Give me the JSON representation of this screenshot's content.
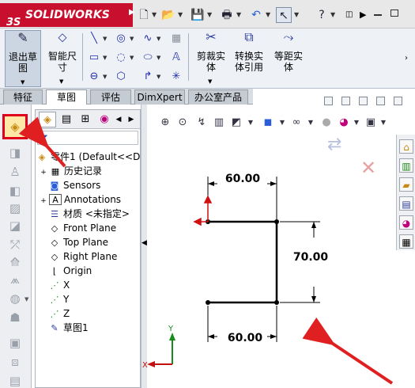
{
  "app": {
    "name": "SOLIDWORKS",
    "logo_mark": "3S"
  },
  "quick_access": {
    "items": [
      "new-icon",
      "open-icon",
      "save-icon",
      "print-icon",
      "undo-icon",
      "select-icon",
      "help-icon"
    ]
  },
  "command_manager": {
    "exit_sketch": "退出草图",
    "smart_dimension": "智能尺寸",
    "trim_entities": "剪裁实体",
    "convert_entities": "转换实体引用",
    "offset_entities": "等距实体"
  },
  "tabs": [
    "特征",
    "草图",
    "评估",
    "DimXpert",
    "办公室产品"
  ],
  "active_tab": "草图",
  "feature_tree": {
    "root": "零件1  (Default<<D",
    "items": [
      "历史记录",
      "Sensors",
      "Annotations",
      "材质 <未指定>",
      "Front Plane",
      "Top Plane",
      "Right Plane",
      "Origin",
      "X",
      "Y",
      "Z",
      "草图1"
    ]
  },
  "sketch": {
    "dim_top": "60.00",
    "dim_right": "70.00",
    "dim_bottom": "60.00",
    "triad_y": "Y",
    "triad_x": "X"
  },
  "colors": {
    "logo_red": "#c8102e",
    "highlight_red": "#e0001b",
    "arrow_red": "#e02020"
  }
}
